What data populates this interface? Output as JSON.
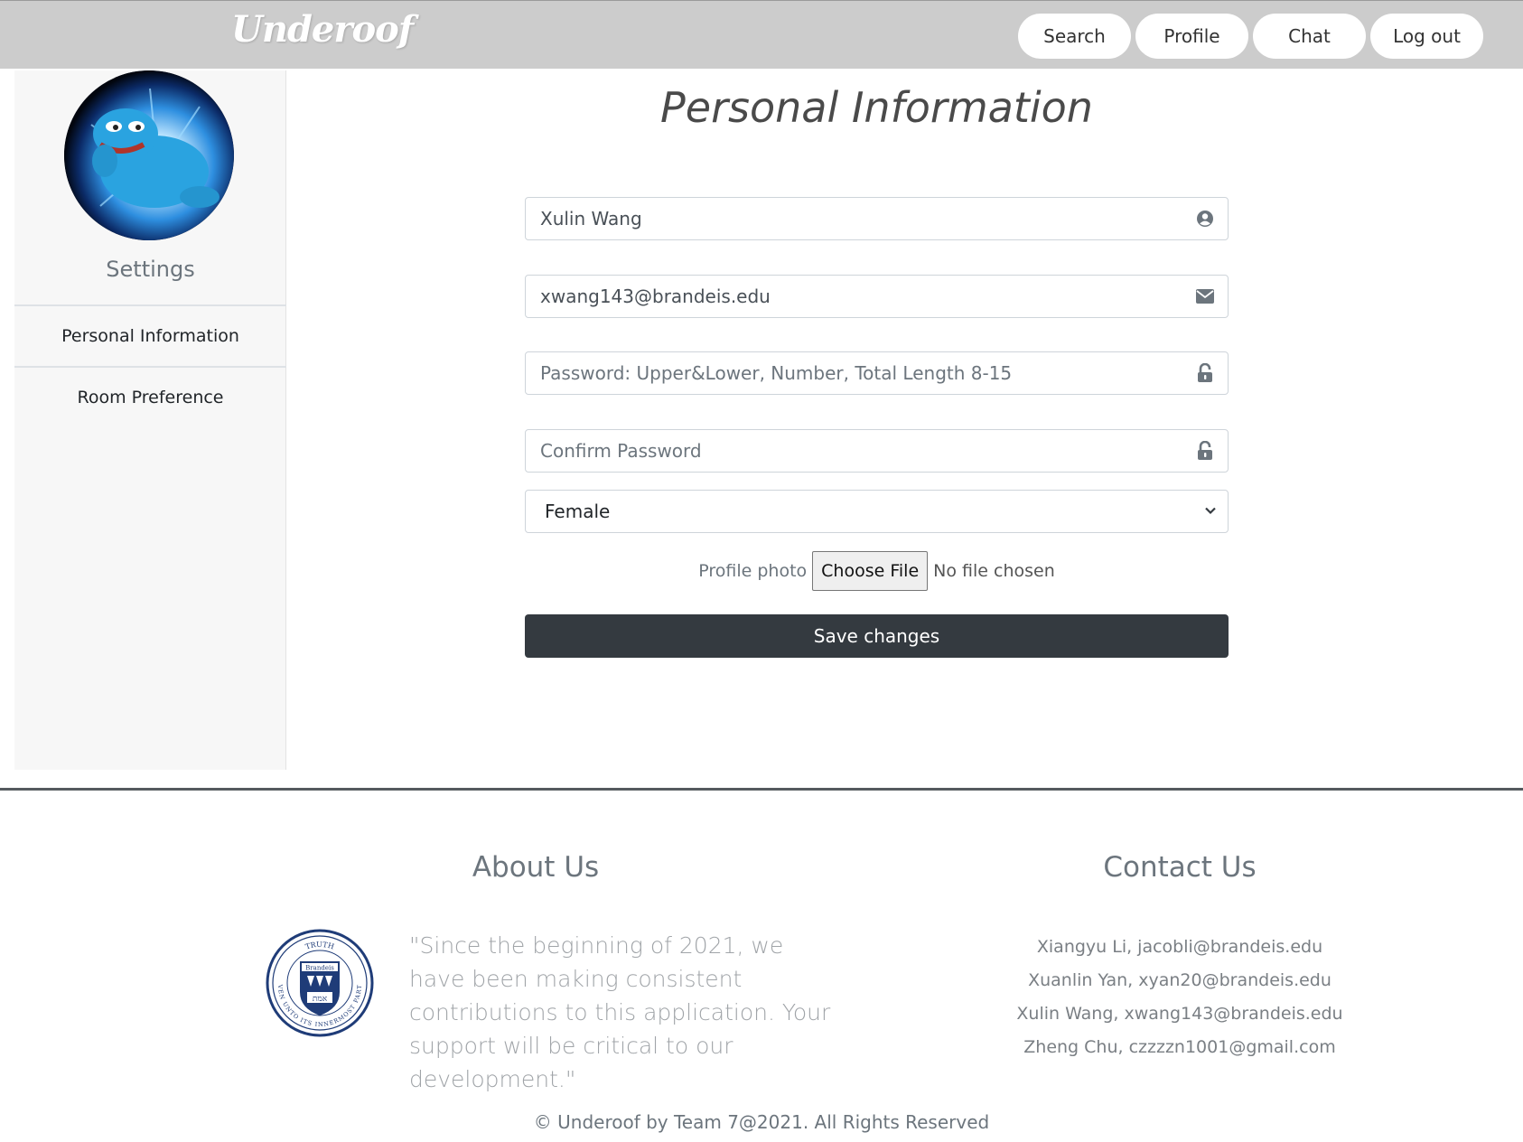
{
  "navbar": {
    "brand": "Underoof",
    "buttons": [
      "Search",
      "Profile",
      "Chat",
      "Log out"
    ]
  },
  "sidebar": {
    "title": "Settings",
    "items": [
      "Personal Information",
      "Room Preference"
    ]
  },
  "form": {
    "title": "Personal Information",
    "name_value": "Xulin Wang",
    "email_value": "xwang143@brandeis.edu",
    "password_placeholder": "Password: Upper&Lower, Number, Total Length 8-15",
    "confirm_placeholder": "Confirm Password",
    "gender_selected": "Female",
    "photo_label": "Profile photo",
    "choose_file_label": "Choose File",
    "no_file_text": "No file chosen",
    "save_label": "Save changes"
  },
  "footer": {
    "about_heading": "About Us",
    "about_quote": "\"Since the beginning of 2021, we have been making consistent contributions to this application. Your support will be critical to our development.\"",
    "seal_text": [
      "TRUTH",
      "EVEN UNTO ITS INNERMOST PARTS",
      "Brandeis",
      "אמת"
    ],
    "contact_heading": "Contact Us",
    "contacts": [
      "Xiangyu Li, jacobli@brandeis.edu",
      "Xuanlin Yan, xyan20@brandeis.edu",
      "Xulin Wang, xwang143@brandeis.edu",
      "Zheng Chu, czzzzn1001@gmail.com"
    ],
    "copyright": "© Underoof by Team 7@2021. All Rights Reserved"
  },
  "icons": {
    "name_field": "user-circle-icon",
    "email_field": "envelope-icon",
    "password_field": "unlock-icon",
    "confirm_field": "unlock-icon",
    "select": "chevron-down-icon"
  },
  "colors": {
    "navbar_bg": "#cccccc",
    "save_button_bg": "#343a40",
    "sidebar_bg": "#f7f7f7",
    "seal_blue": "#1f3c78"
  }
}
